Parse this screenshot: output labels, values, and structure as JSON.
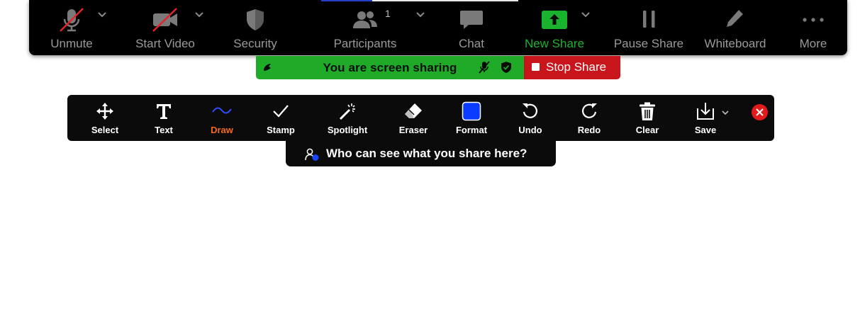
{
  "meeting_bar": {
    "unmute": "Unmute",
    "start_video": "Start Video",
    "security": "Security",
    "participants": "Participants",
    "participants_count": "1",
    "chat": "Chat",
    "new_share": "New Share",
    "pause_share": "Pause Share",
    "whiteboard": "Whiteboard",
    "more": "More"
  },
  "share_banner": {
    "message": "You are screen sharing",
    "stop_label": "Stop Share"
  },
  "annotation_toolbar": {
    "tools": [
      {
        "label": "Select"
      },
      {
        "label": "Text"
      },
      {
        "label": "Draw"
      },
      {
        "label": "Stamp"
      },
      {
        "label": "Spotlight"
      },
      {
        "label": "Eraser"
      },
      {
        "label": "Format"
      },
      {
        "label": "Undo"
      },
      {
        "label": "Redo"
      },
      {
        "label": "Clear"
      },
      {
        "label": "Save"
      }
    ],
    "active_tool": "Draw",
    "format_color": "#0a3cff"
  },
  "tooltip": {
    "text": "Who can see what you share here?"
  },
  "colors": {
    "green": "#1fab27",
    "stop_red": "#c8151b",
    "active_orange": "#f26a1b"
  }
}
